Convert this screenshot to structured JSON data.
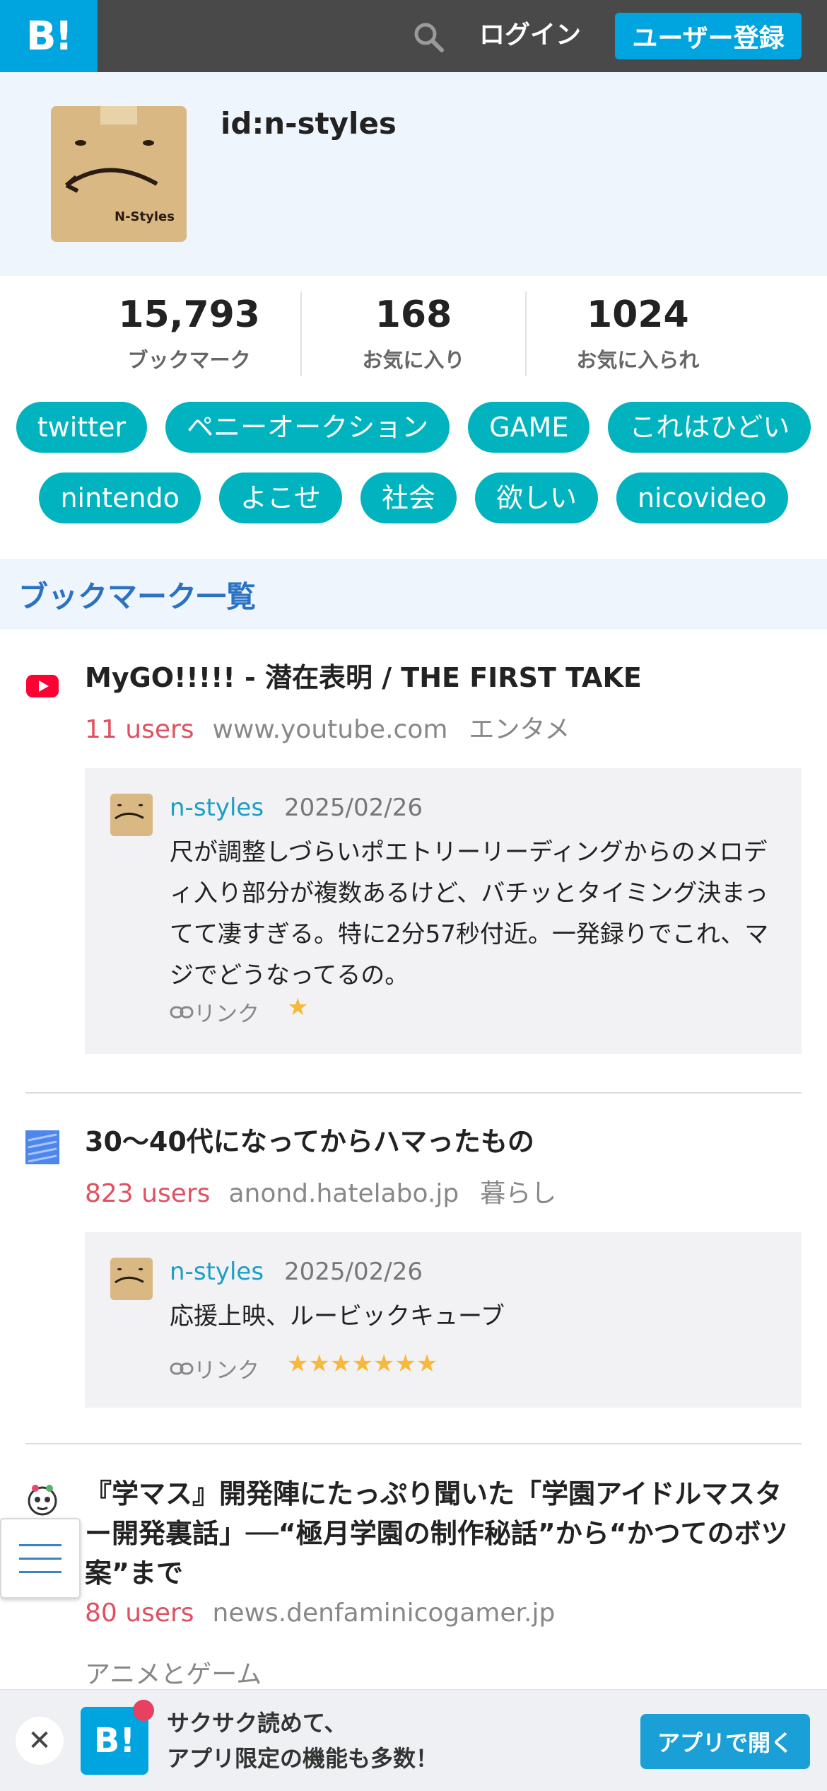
{
  "header": {
    "logo_text": "B!",
    "login_label": "ログイン",
    "register_label": "ユーザー登録"
  },
  "profile": {
    "username": "id:n-styles",
    "avatar_text": "N-Styles"
  },
  "stats": [
    {
      "value": "15,793",
      "label": "ブックマーク"
    },
    {
      "value": "168",
      "label": "お気に入り"
    },
    {
      "value": "1024",
      "label": "お気に入られ"
    }
  ],
  "tags": [
    "twitter",
    "ペニーオークション",
    "GAME",
    "これはひどい",
    "nintendo",
    "よこせ",
    "社会",
    "欲しい",
    "nicovideo"
  ],
  "section": {
    "title": "ブックマーク一覧"
  },
  "entries": [
    {
      "title": "MyGO!!!!! - 潜在表明 / THE FIRST TAKE",
      "users": "11 users",
      "domain": "www.youtube.com",
      "category": "エンタメ",
      "comment": {
        "user": "n-styles",
        "date": "2025/02/26",
        "text": "尺が調整しづらいポエトリーリーディングからのメロディ入り部分が複数あるけど、バチッとタイミング決まってて凄すぎる。特に2分57秒付近。一発録りでこれ、マジでどうなってるの。",
        "link_label": "リンク",
        "stars": "★"
      }
    },
    {
      "title": "30〜40代になってからハマったもの",
      "users": "823 users",
      "domain": "anond.hatelabo.jp",
      "category": "暮らし",
      "comment": {
        "user": "n-styles",
        "date": "2025/02/26",
        "text": "応援上映、ルービックキューブ",
        "link_label": "リンク",
        "stars": "★★★★★★★"
      }
    },
    {
      "title": "『学マス』開発陣にたっぷり聞いた「学園アイドルマスター開発裏話」──“極月学園の制作秘話”から“かつてのボツ案”まで",
      "users": "80 users",
      "domain": "news.denfaminicogamer.jp",
      "category": "アニメとゲーム"
    }
  ],
  "banner": {
    "app_icon_text": "B!",
    "line1": "サクサク読めて、",
    "line2": "アプリ限定の機能も多数！",
    "open_label": "アプリで開く",
    "close_symbol": "✕"
  }
}
